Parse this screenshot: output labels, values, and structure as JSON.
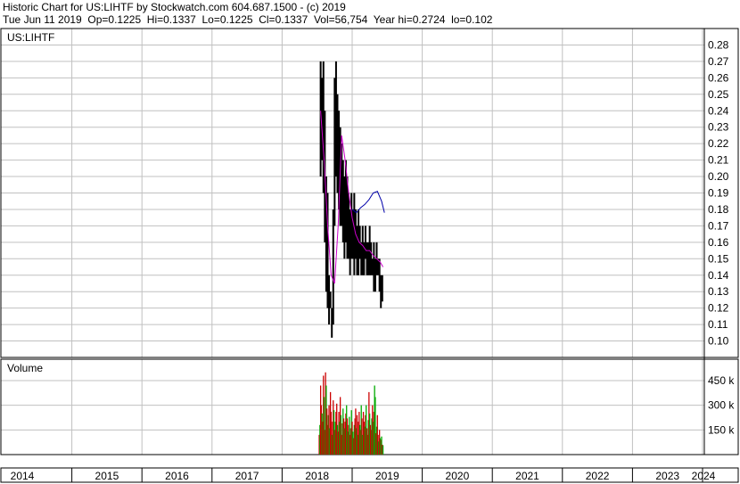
{
  "header": {
    "line1": "Historic Chart for US:LIHTF by Stockwatch.com 604.687.1500 - (c) 2019",
    "line2": "Tue Jun 11 2019  Op=0.1225  Hi=0.1337  Lo=0.1225  Cl=0.1337  Vol=56,754  Year hi=0.2724  lo=0.102"
  },
  "chart_data": [
    {
      "type": "line",
      "title": "US:LIHTF",
      "ylim": [
        0.09,
        0.29
      ],
      "y_ticks": [
        "0.28",
        "0.27",
        "0.26",
        "0.25",
        "0.24",
        "0.23",
        "0.22",
        "0.21",
        "0.20",
        "0.19",
        "0.18",
        "0.17",
        "0.16",
        "0.15",
        "0.14",
        "0.13",
        "0.12",
        "0.11",
        "0.10"
      ],
      "y_tick_values": [
        0.28,
        0.27,
        0.26,
        0.25,
        0.24,
        0.23,
        0.22,
        0.21,
        0.2,
        0.19,
        0.18,
        0.17,
        0.16,
        0.15,
        0.14,
        0.13,
        0.12,
        0.11,
        0.1
      ],
      "grid": true,
      "colors": {
        "price": "#000000",
        "ma_short": "#cc00cc",
        "ma_long": "#0000aa",
        "grid": "#c0c0c0"
      },
      "series": [
        {
          "style": "price-range",
          "x": [
            2018.55,
            2018.57,
            2018.59,
            2018.61,
            2018.63,
            2018.65,
            2018.67,
            2018.69,
            2018.71,
            2018.73,
            2018.75,
            2018.77,
            2018.79,
            2018.81,
            2018.83,
            2018.85,
            2018.87,
            2018.89,
            2018.91,
            2018.93,
            2018.95,
            2018.97,
            2018.99,
            2019.01,
            2019.03,
            2019.05,
            2019.07,
            2019.09,
            2019.11,
            2019.13,
            2019.15,
            2019.17,
            2019.19,
            2019.21,
            2019.23,
            2019.25,
            2019.27,
            2019.29,
            2019.31,
            2019.33,
            2019.35,
            2019.37,
            2019.39,
            2019.41,
            2019.43
          ],
          "high": [
            0.27,
            0.26,
            0.27,
            0.24,
            0.2,
            0.19,
            0.14,
            0.13,
            0.12,
            0.18,
            0.26,
            0.27,
            0.25,
            0.24,
            0.23,
            0.22,
            0.21,
            0.2,
            0.21,
            0.2,
            0.19,
            0.18,
            0.19,
            0.18,
            0.19,
            0.18,
            0.17,
            0.18,
            0.17,
            0.16,
            0.17,
            0.16,
            0.17,
            0.16,
            0.16,
            0.17,
            0.16,
            0.15,
            0.16,
            0.15,
            0.16,
            0.15,
            0.15,
            0.14,
            0.14
          ],
          "low": [
            0.2,
            0.21,
            0.19,
            0.16,
            0.13,
            0.12,
            0.11,
            0.12,
            0.102,
            0.11,
            0.17,
            0.2,
            0.19,
            0.18,
            0.17,
            0.17,
            0.16,
            0.15,
            0.16,
            0.15,
            0.15,
            0.14,
            0.15,
            0.15,
            0.14,
            0.15,
            0.14,
            0.14,
            0.15,
            0.14,
            0.14,
            0.14,
            0.15,
            0.14,
            0.14,
            0.14,
            0.14,
            0.14,
            0.13,
            0.13,
            0.14,
            0.14,
            0.13,
            0.12,
            0.124
          ]
        },
        {
          "style": "line",
          "color": "#cc00cc",
          "x": [
            2018.55,
            2018.6,
            2018.65,
            2018.7,
            2018.75,
            2018.8,
            2018.85,
            2018.9,
            2018.95,
            2019.0,
            2019.05,
            2019.1,
            2019.15,
            2019.2,
            2019.25,
            2019.3,
            2019.35,
            2019.4,
            2019.44
          ],
          "values": [
            0.24,
            0.21,
            0.17,
            0.14,
            0.135,
            0.17,
            0.225,
            0.21,
            0.19,
            0.175,
            0.165,
            0.16,
            0.158,
            0.155,
            0.155,
            0.152,
            0.15,
            0.148,
            0.145
          ]
        },
        {
          "style": "line",
          "color": "#0000aa",
          "x": [
            2019.0,
            2019.06,
            2019.12,
            2019.18,
            2019.24,
            2019.3,
            2019.36,
            2019.42,
            2019.46
          ],
          "values": [
            0.18,
            0.178,
            0.181,
            0.183,
            0.186,
            0.19,
            0.191,
            0.185,
            0.178
          ]
        }
      ]
    },
    {
      "type": "bar",
      "title": "Volume",
      "ylim": [
        0,
        580000
      ],
      "y_ticks": [
        "450 k",
        "300 k",
        "150 k"
      ],
      "y_tick_values": [
        450000,
        300000,
        150000
      ],
      "colors": {
        "up": "#00aa00",
        "down": "#cc0000"
      },
      "x": [
        2018.53,
        2018.54,
        2018.55,
        2018.56,
        2018.57,
        2018.58,
        2018.59,
        2018.6,
        2018.61,
        2018.62,
        2018.63,
        2018.64,
        2018.65,
        2018.66,
        2018.67,
        2018.68,
        2018.69,
        2018.7,
        2018.71,
        2018.72,
        2018.73,
        2018.74,
        2018.75,
        2018.76,
        2018.77,
        2018.78,
        2018.79,
        2018.8,
        2018.81,
        2018.82,
        2018.83,
        2018.84,
        2018.85,
        2018.86,
        2018.87,
        2018.88,
        2018.89,
        2018.9,
        2018.91,
        2018.92,
        2018.93,
        2018.94,
        2018.95,
        2018.96,
        2018.97,
        2018.98,
        2018.99,
        2019.0,
        2019.01,
        2019.02,
        2019.03,
        2019.04,
        2019.05,
        2019.06,
        2019.07,
        2019.08,
        2019.09,
        2019.1,
        2019.11,
        2019.12,
        2019.13,
        2019.14,
        2019.15,
        2019.16,
        2019.17,
        2019.18,
        2019.19,
        2019.2,
        2019.21,
        2019.22,
        2019.23,
        2019.24,
        2019.25,
        2019.26,
        2019.27,
        2019.28,
        2019.29,
        2019.3,
        2019.31,
        2019.32,
        2019.33,
        2019.34,
        2019.35,
        2019.36,
        2019.37,
        2019.38,
        2019.39,
        2019.4,
        2019.41,
        2019.42,
        2019.43,
        2019.44
      ],
      "values": [
        120000,
        180000,
        420000,
        300000,
        250000,
        200000,
        480000,
        350000,
        150000,
        500000,
        420000,
        280000,
        180000,
        240000,
        300000,
        160000,
        380000,
        260000,
        120000,
        200000,
        330000,
        270000,
        150000,
        200000,
        260000,
        310000,
        180000,
        140000,
        260000,
        200000,
        350000,
        240000,
        120000,
        190000,
        280000,
        220000,
        160000,
        200000,
        250000,
        300000,
        220000,
        140000,
        180000,
        230000,
        120000,
        160000,
        270000,
        200000,
        140000,
        100000,
        180000,
        220000,
        280000,
        160000,
        240000,
        120000,
        200000,
        260000,
        180000,
        150000,
        300000,
        220000,
        120000,
        260000,
        200000,
        170000,
        240000,
        300000,
        160000,
        120000,
        210000,
        380000,
        250000,
        180000,
        150000,
        220000,
        300000,
        200000,
        260000,
        420000,
        350000,
        130000,
        170000,
        240000,
        120000,
        80000,
        150000,
        100000,
        90000,
        110000,
        60000,
        56754
      ],
      "directions": [
        "down",
        "up",
        "down",
        "down",
        "up",
        "down",
        "down",
        "up",
        "down",
        "down",
        "up",
        "down",
        "down",
        "up",
        "down",
        "up",
        "down",
        "down",
        "up",
        "down",
        "down",
        "up",
        "down",
        "up",
        "down",
        "down",
        "up",
        "down",
        "down",
        "up",
        "down",
        "up",
        "down",
        "down",
        "up",
        "down",
        "up",
        "down",
        "down",
        "up",
        "down",
        "up",
        "down",
        "up",
        "down",
        "down",
        "up",
        "down",
        "up",
        "down",
        "up",
        "down",
        "down",
        "up",
        "down",
        "up",
        "down",
        "down",
        "up",
        "down",
        "up",
        "down",
        "up",
        "down",
        "down",
        "up",
        "down",
        "up",
        "down",
        "down",
        "up",
        "down",
        "up",
        "down",
        "down",
        "up",
        "down",
        "up",
        "down",
        "up",
        "up",
        "down",
        "up",
        "down",
        "down",
        "up",
        "down",
        "up",
        "down",
        "up",
        "down",
        "up"
      ]
    }
  ],
  "x_axis": {
    "labels": [
      "2014",
      "2015",
      "2016",
      "2017",
      "2018",
      "2019",
      "2020",
      "2021",
      "2022",
      "2023",
      "2024"
    ],
    "years": [
      2014,
      2015,
      2016,
      2017,
      2018,
      2019,
      2020,
      2021,
      2022,
      2023,
      2024
    ]
  }
}
